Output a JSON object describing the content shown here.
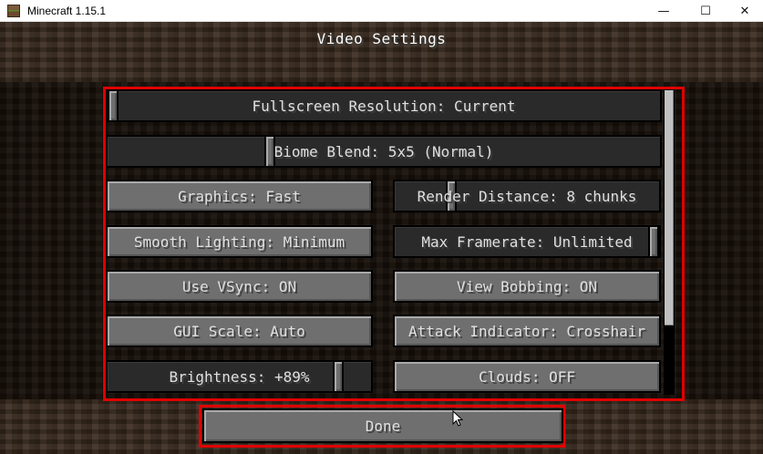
{
  "window": {
    "title": "Minecraft 1.15.1",
    "controls": [
      "minimize-icon",
      "maximize-icon",
      "close-icon"
    ]
  },
  "screen": {
    "title": "Video Settings"
  },
  "options": {
    "fullscreen_resolution": {
      "label": "Fullscreen Resolution: Current",
      "slider_fraction": 0.0
    },
    "biome_blend": {
      "label": "Biome Blend: 5x5 (Normal)",
      "slider_fraction": 0.29
    },
    "graphics": {
      "label": "Graphics: Fast"
    },
    "render_distance": {
      "label": "Render Distance: 8 chunks",
      "slider_fraction": 0.2
    },
    "smooth_lighting": {
      "label": "Smooth Lighting: Minimum"
    },
    "max_framerate": {
      "label": "Max Framerate: Unlimited",
      "slider_fraction": 1.0
    },
    "use_vsync": {
      "label": "Use VSync: ON"
    },
    "view_bobbing": {
      "label": "View Bobbing: ON"
    },
    "gui_scale": {
      "label": "GUI Scale: Auto"
    },
    "attack_indicator": {
      "label": "Attack Indicator: Crosshair"
    },
    "brightness": {
      "label": "Brightness: +89%",
      "slider_fraction": 0.89
    },
    "clouds": {
      "label": "Clouds: OFF"
    }
  },
  "footer": {
    "done_label": "Done"
  },
  "colors": {
    "highlight": "#e00000",
    "button_face": "#6f6f6f",
    "slider_track": "#2a2a2a",
    "text": "#e0e0e0"
  }
}
